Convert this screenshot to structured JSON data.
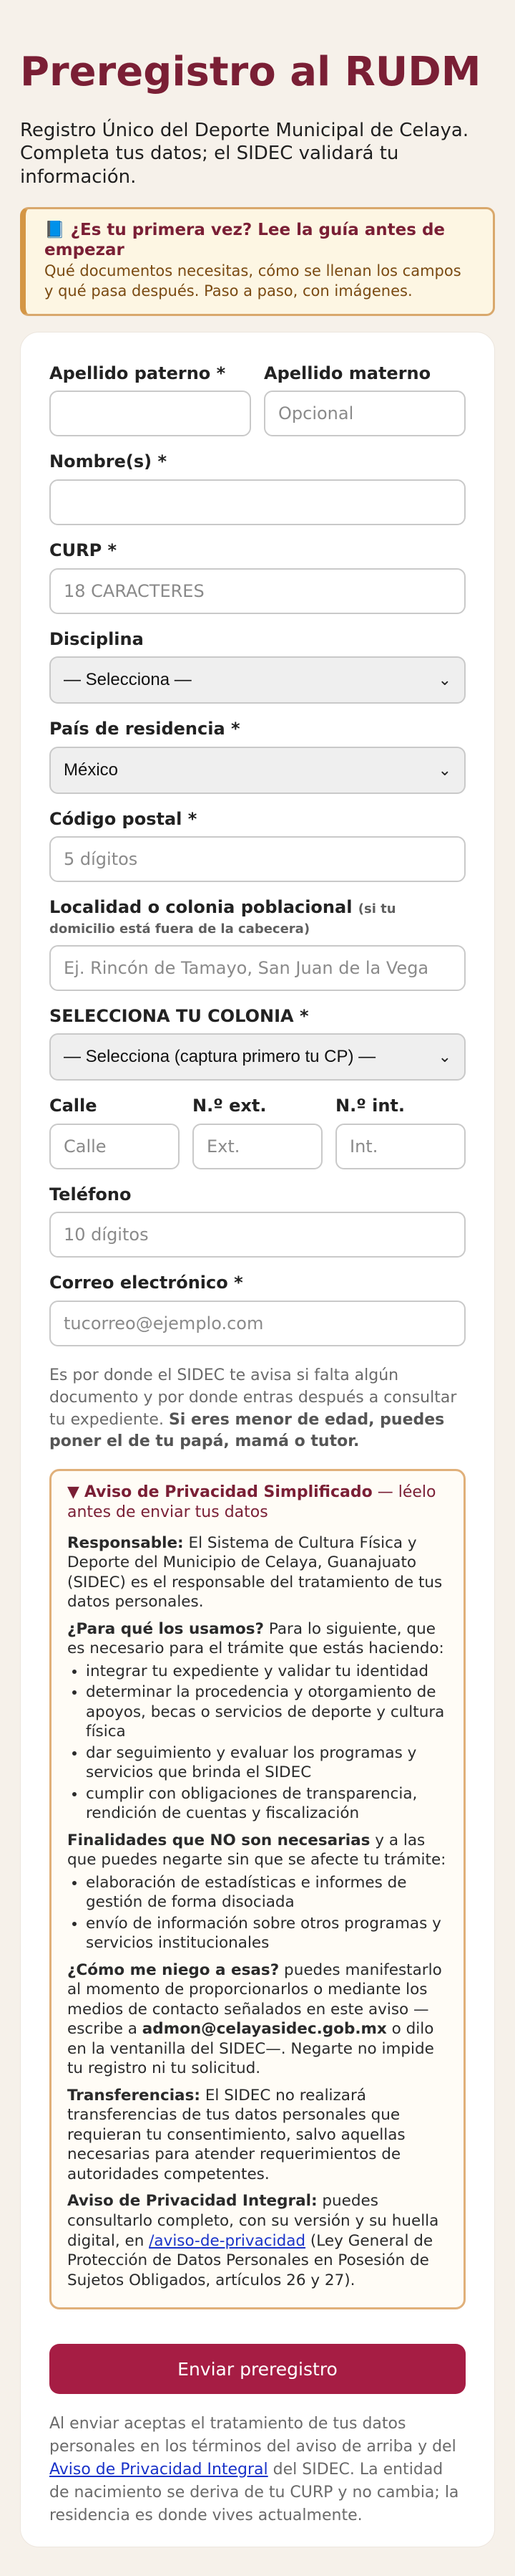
{
  "title": "Preregistro al RUDM",
  "intro": "Registro Único del Deporte Municipal de Celaya. Completa tus datos; el SIDEC validará tu información.",
  "guide": {
    "icon": "book-icon",
    "icon_glyph": "📘",
    "title": "¿Es tu primera vez? Lee la guía antes de empezar",
    "text": "Qué documentos necesitas, cómo se llenan los campos y qué pasa después. Paso a paso, con imágenes."
  },
  "form": {
    "apellido_paterno": {
      "label": "Apellido paterno *",
      "value": "",
      "placeholder": ""
    },
    "apellido_materno": {
      "label": "Apellido materno",
      "value": "",
      "placeholder": "Opcional"
    },
    "nombres": {
      "label": "Nombre(s) *",
      "value": "",
      "placeholder": ""
    },
    "curp": {
      "label": "CURP *",
      "value": "",
      "placeholder": "18 CARACTERES"
    },
    "disciplina": {
      "label": "Disciplina",
      "selected": "— Selecciona —"
    },
    "pais": {
      "label": "País de residencia *",
      "selected": "México"
    },
    "cp": {
      "label": "Código postal *",
      "value": "",
      "placeholder": "5 dígitos"
    },
    "localidad": {
      "label": "Localidad o colonia poblacional",
      "hint": "(si tu domicilio está fuera de la cabecera)",
      "value": "",
      "placeholder": "Ej. Rincón de Tamayo, San Juan de la Vega"
    },
    "colonia": {
      "label": "SELECCIONA TU COLONIA *",
      "selected": "— Selecciona (captura primero tu CP) —"
    },
    "calle": {
      "label": "Calle",
      "value": "",
      "placeholder": "Calle"
    },
    "ext": {
      "label": "N.º ext.",
      "value": "",
      "placeholder": "Ext."
    },
    "int": {
      "label": "N.º int.",
      "value": "",
      "placeholder": "Int."
    },
    "telefono": {
      "label": "Teléfono",
      "value": "",
      "placeholder": "10 dígitos"
    },
    "correo": {
      "label": "Correo electrónico *",
      "value": "",
      "placeholder": "tucorreo@ejemplo.com"
    }
  },
  "note": {
    "text": "Es por donde el SIDEC te avisa si falta algún documento y por donde entras después a consultar tu expediente.",
    "bold": "Si eres menor de edad, puedes poner el de tu papá, mamá o tutor."
  },
  "privacy": {
    "summary_bold": "Aviso de Privacidad Simplificado",
    "summary_rest": "— léelo antes de enviar tus datos",
    "responsable_bold": "Responsable:",
    "responsable_text": "El Sistema de Cultura Física y Deporte del Municipio de Celaya, Guanajuato (SIDEC) es el responsable del tratamiento de tus datos personales.",
    "uso_bold": "¿Para qué los usamos?",
    "uso_text": "Para lo siguiente, que es necesario para el trámite que estás haciendo:",
    "usos": [
      "integrar tu expediente y validar tu identidad",
      "determinar la procedencia y otorgamiento de apoyos, becas o servicios de deporte y cultura física",
      "dar seguimiento y evaluar los programas y servicios que brinda el SIDEC",
      "cumplir con obligaciones de transparencia, rendición de cuentas y fiscalización"
    ],
    "no_nec_bold": "Finalidades que NO son necesarias",
    "no_nec_text": "y a las que puedes negarte sin que se afecte tu trámite:",
    "no_nec": [
      "elaboración de estadísticas e informes de gestión de forma disociada",
      "envío de información sobre otros programas y servicios institucionales"
    ],
    "negar_bold": "¿Cómo me niego a esas?",
    "negar_text1": "puedes manifestarlo al momento de proporcionarlos o mediante los medios de contacto señalados en este aviso — escribe a",
    "negar_email": "admon@celayasidec.gob.mx",
    "negar_text2": "o dilo en la ventanilla del SIDEC—. Negarte no impide tu registro ni tu solicitud.",
    "transf_bold": "Transferencias:",
    "transf_text": "El SIDEC no realizará transferencias de tus datos personales que requieran tu consentimiento, salvo aquellas necesarias para atender requerimientos de autoridades competentes.",
    "integral_bold": "Aviso de Privacidad Integral:",
    "integral_text1": "puedes consultarlo completo, con su versión y su huella digital, en",
    "integral_link": "/aviso-de-privacidad",
    "integral_text2": "(Ley General de Protección de Datos Personales en Posesión de Sujetos Obligados, artículos 26 y 27)."
  },
  "submit_label": "Enviar preregistro",
  "footnote": {
    "text1": "Al enviar aceptas el tratamiento de tus datos personales en los términos del aviso de arriba y del",
    "link": "Aviso de Privacidad Integral",
    "text2": "del SIDEC. La entidad de nacimiento se deriva de tu CURP y no cambia; la residencia es donde vives actualmente."
  },
  "colors": {
    "accent": "#7a1f35",
    "button": "#a61d44",
    "background": "#f6f1ea",
    "guide_border": "#d9a86c"
  }
}
